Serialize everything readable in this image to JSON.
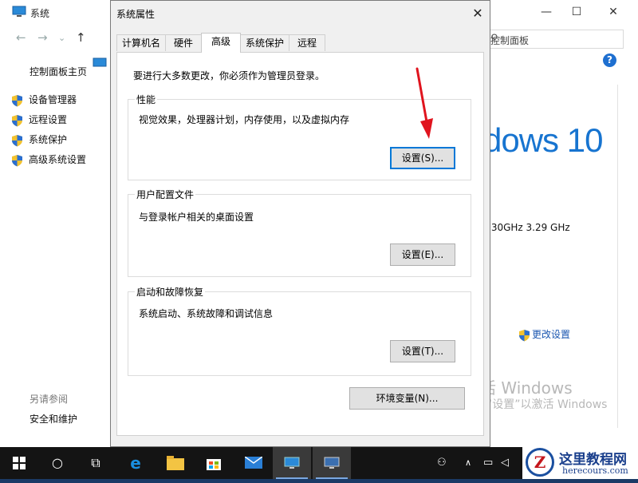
{
  "background_window": {
    "title": "系统",
    "search_placeholder": "控制面板",
    "help": "?",
    "nav": {
      "home": "控制面板主页",
      "items": [
        "设备管理器",
        "远程设置",
        "系统保护",
        "高级系统设置"
      ],
      "see_also": "另请参阅",
      "security": "安全和维护"
    },
    "windows_brand": "dows 10",
    "cpu_speed": ".30GHz   3.29 GHz",
    "change_settings": "更改设置",
    "activate_title": "激活 Windows",
    "activate_hint": "转到“设置”以激活 Windows"
  },
  "dialog": {
    "title": "系统属性",
    "close": "✕",
    "tabs": [
      "计算机名",
      "硬件",
      "高级",
      "系统保护",
      "远程"
    ],
    "active_tab": "高级",
    "admin_note": "要进行大多数更改，你必须作为管理员登录。",
    "groups": [
      {
        "legend": "性能",
        "desc": "视觉效果，处理器计划，内存使用，以及虚拟内存",
        "button": "设置(S)..."
      },
      {
        "legend": "用户配置文件",
        "desc": "与登录帐户相关的桌面设置",
        "button": "设置(E)..."
      },
      {
        "legend": "启动和故障恢复",
        "desc": "系统启动、系统故障和调试信息",
        "button": "设置(T)..."
      }
    ],
    "env_button": "环境变量(N)..."
  },
  "watermark": {
    "text": "这里教程网",
    "url": "herecours.com",
    "logo_letter": "Z"
  },
  "colors": {
    "accent": "#0078d7",
    "arrow": "#e0141e",
    "link": "#1a56b0"
  }
}
